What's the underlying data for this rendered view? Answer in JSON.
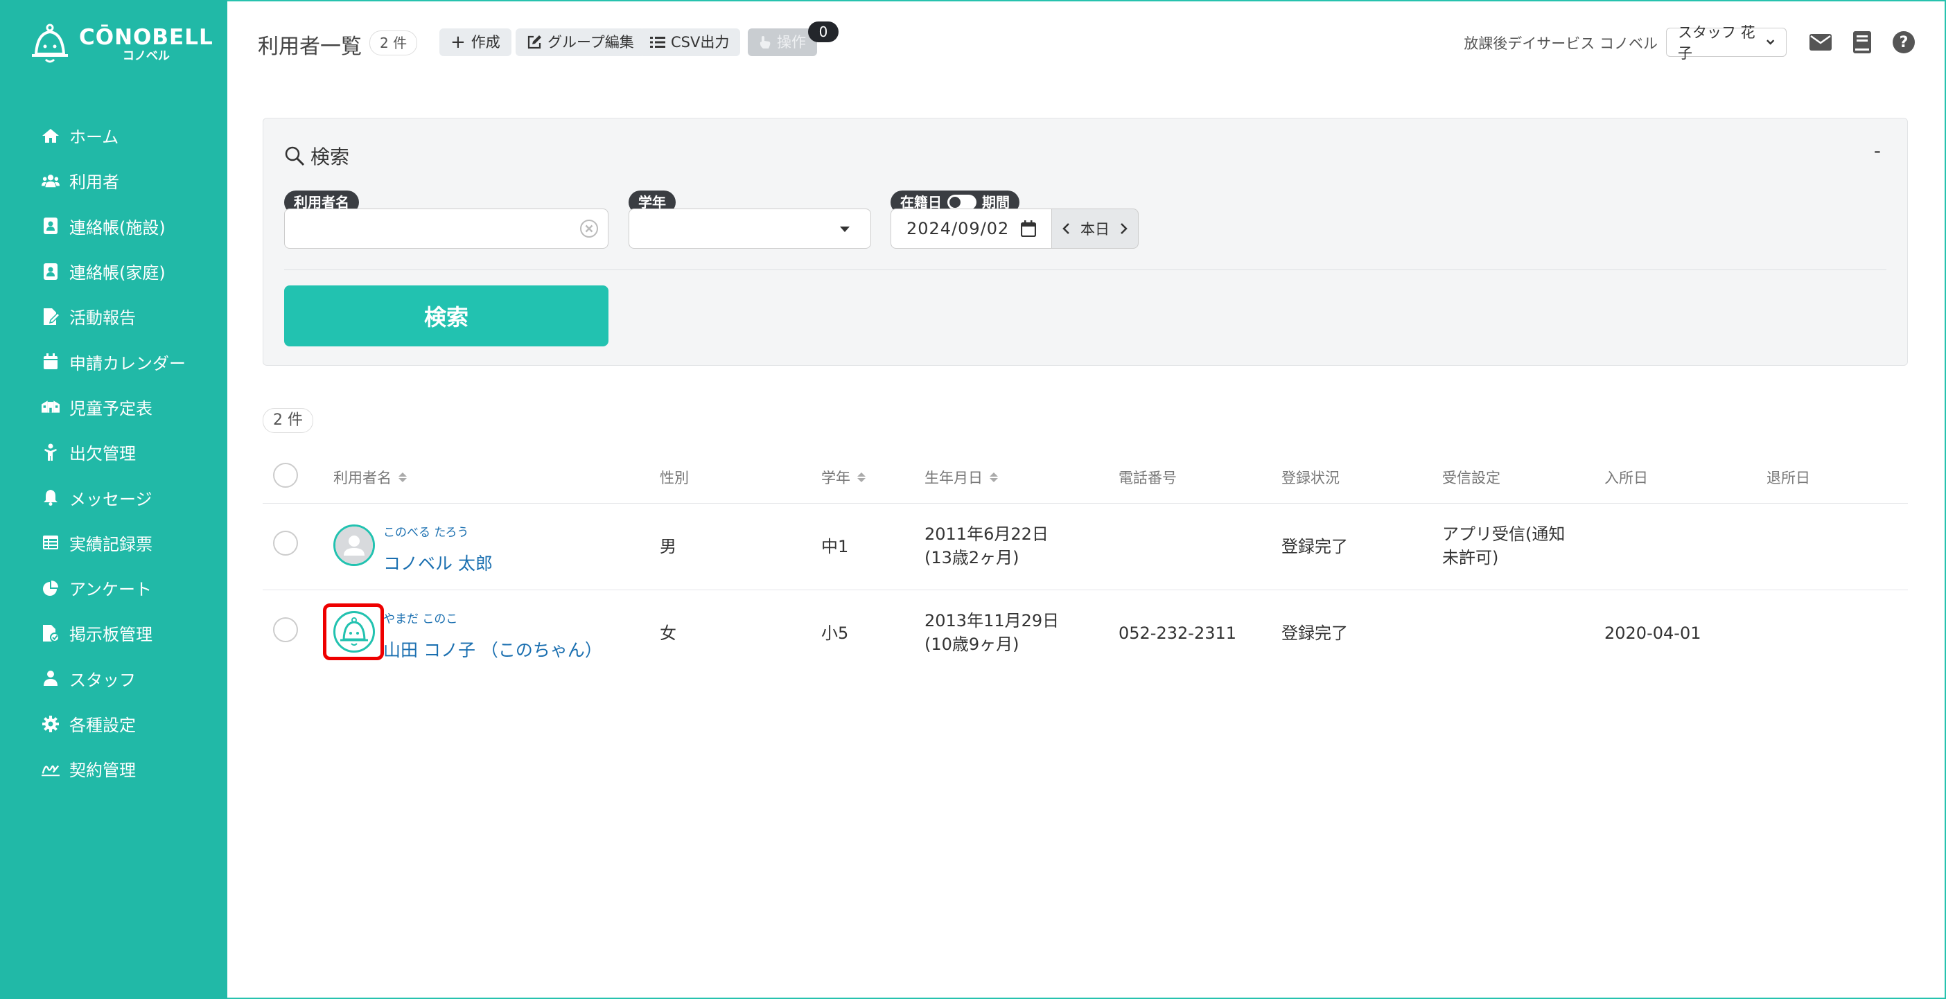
{
  "app": {
    "logo_main": "CŌNOBELL",
    "logo_sub": "コノベル"
  },
  "colors": {
    "primary": "#21b9a7",
    "button": "#22c2b0",
    "link": "#1a6fb0",
    "highlight": "#ee0000"
  },
  "sidebar": {
    "items": [
      {
        "label": "ホーム",
        "icon": "home-icon"
      },
      {
        "label": "利用者",
        "icon": "users-icon"
      },
      {
        "label": "連絡帳(施設)",
        "icon": "contact-book-icon"
      },
      {
        "label": "連絡帳(家庭)",
        "icon": "contact-book-icon"
      },
      {
        "label": "活動報告",
        "icon": "report-icon"
      },
      {
        "label": "申請カレンダー",
        "icon": "calendar-icon"
      },
      {
        "label": "児童予定表",
        "icon": "schedule-icon"
      },
      {
        "label": "出欠管理",
        "icon": "attendance-icon"
      },
      {
        "label": "メッセージ",
        "icon": "bell-icon"
      },
      {
        "label": "実績記録票",
        "icon": "table-icon"
      },
      {
        "label": "アンケート",
        "icon": "pie-chart-icon"
      },
      {
        "label": "掲示板管理",
        "icon": "bulletin-icon"
      },
      {
        "label": "スタッフ",
        "icon": "staff-icon"
      },
      {
        "label": "各種設定",
        "icon": "gear-icon"
      },
      {
        "label": "契約管理",
        "icon": "contract-icon"
      }
    ]
  },
  "header": {
    "title": "利用者一覧",
    "count": "2 件",
    "create": "作成",
    "group_edit": "グループ編集",
    "csv": "CSV出力",
    "operation": "操作",
    "operation_badge": "0",
    "facility": "放課後デイサービス コノベル",
    "staff": "スタッフ 花子"
  },
  "search": {
    "title": "検索",
    "collapse": "-",
    "name_label": "利用者名",
    "name_value": "",
    "grade_label": "学年",
    "grade_value": "",
    "date_label_left": "在籍日",
    "date_label_right": "期間",
    "date_value": "2024/09/02",
    "today": "本日",
    "button": "検索"
  },
  "results": {
    "count": "2 件",
    "columns": [
      "利用者名",
      "性別",
      "学年",
      "生年月日",
      "電話番号",
      "登録状況",
      "受信設定",
      "入所日",
      "退所日"
    ],
    "rows": [
      {
        "kana": "このべる たろう",
        "name": "コノベル 太郎",
        "gender": "男",
        "grade": "中1",
        "birth": "2011年6月22日",
        "age": "(13歳2ヶ月)",
        "phone": "",
        "status": "登録完了",
        "receive_1": "アプリ受信(通知",
        "receive_2": "未許可)",
        "admission": "",
        "discharge": "",
        "avatar": "default-person"
      },
      {
        "kana": "やまだ このこ",
        "name": "山田 コノ子 （このちゃん）",
        "gender": "女",
        "grade": "小5",
        "birth": "2013年11月29日",
        "age": "(10歳9ヶ月)",
        "phone": "052-232-2311",
        "status": "登録完了",
        "receive_1": "",
        "receive_2": "",
        "admission": "2020-04-01",
        "discharge": "",
        "avatar": "conobell-bell"
      }
    ]
  }
}
